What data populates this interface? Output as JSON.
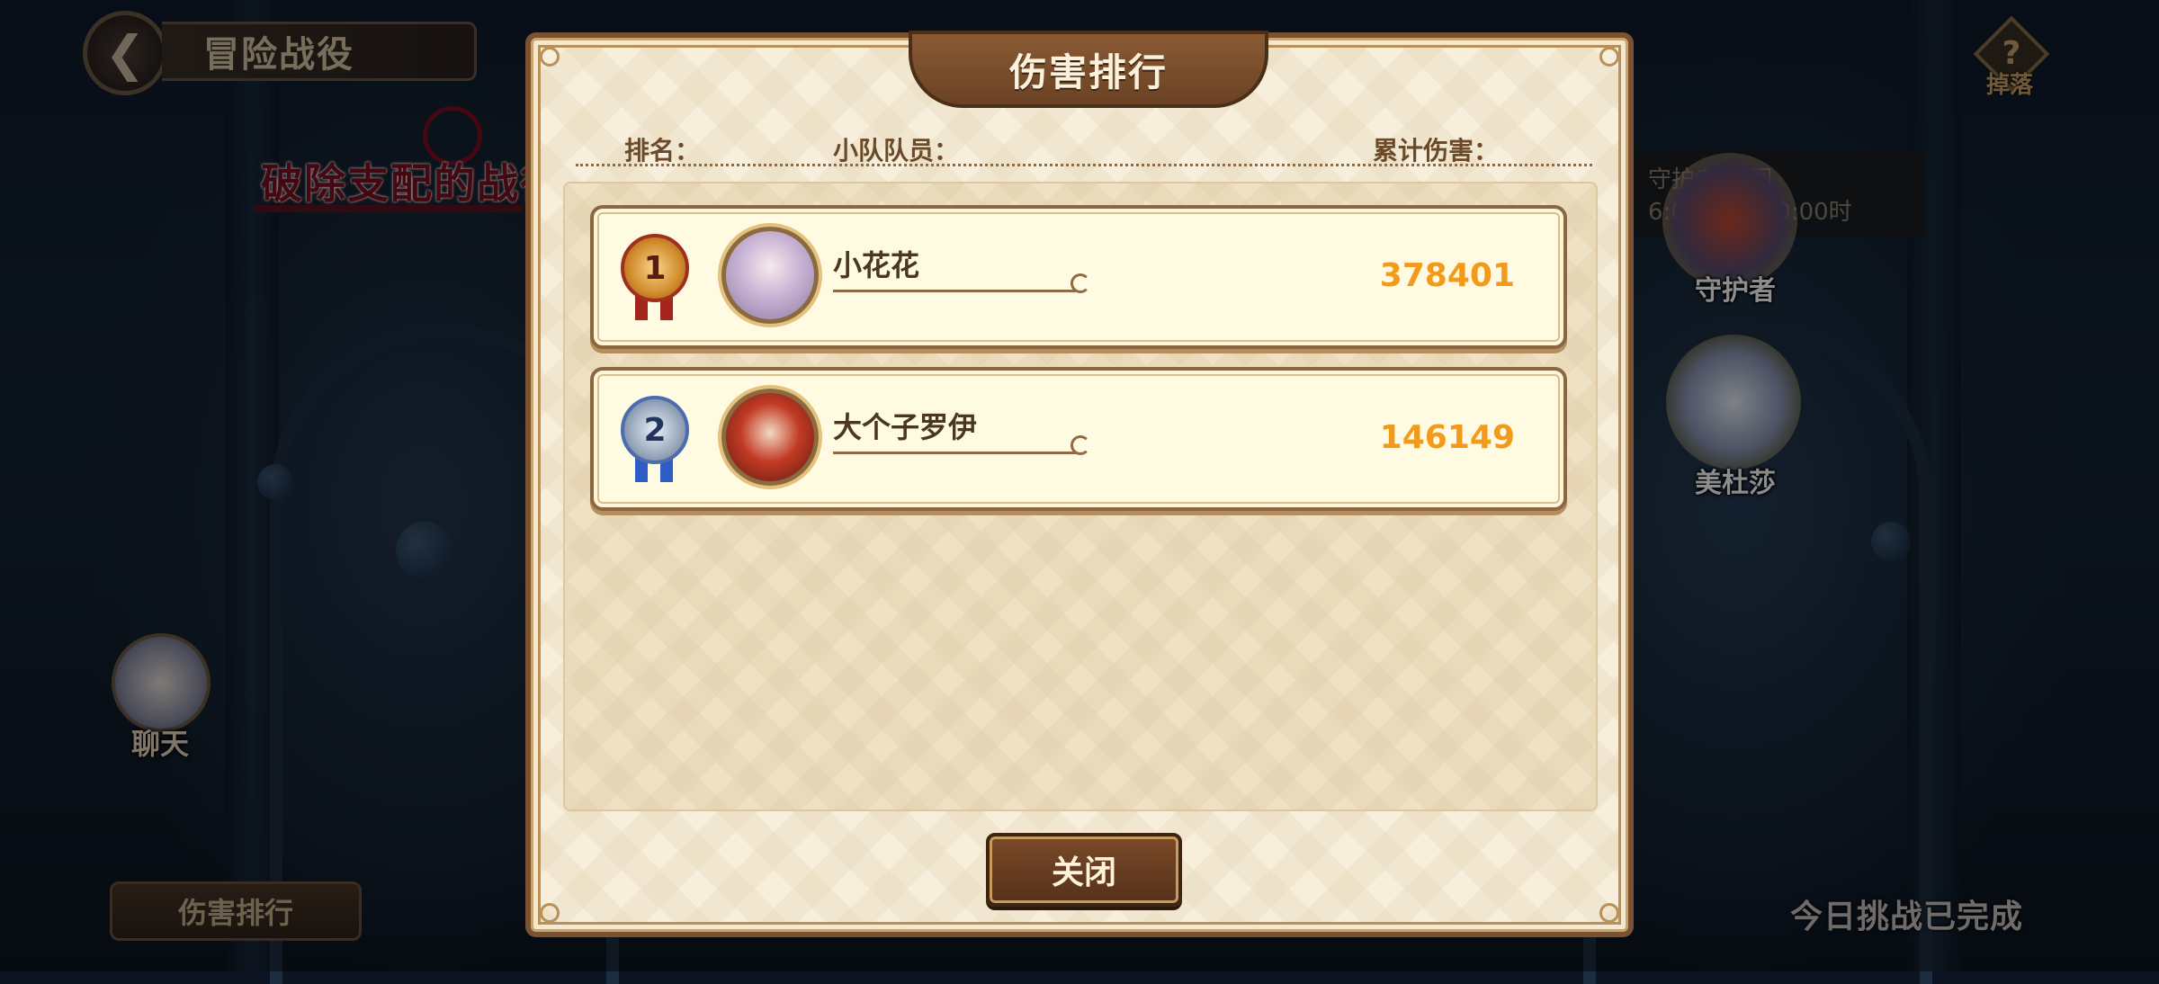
{
  "top_bar": {
    "back_icon": "back-arrow-icon",
    "title": "冒险战役"
  },
  "banner": {
    "title": "破除支配的战役"
  },
  "side": {
    "chat_label": "聊天",
    "rank_button": "伤害排行"
  },
  "help": {
    "icon": "question-mark-icon",
    "label": "掉落"
  },
  "info_strip": {
    "line1": "守护者 时间",
    "line2": "6:00 16日00:00时"
  },
  "bosses": [
    {
      "name": "守护者"
    },
    {
      "name": "美杜莎"
    }
  ],
  "status": {
    "daily_done": "今日挑战已完成"
  },
  "modal": {
    "title": "伤害排行",
    "headers": {
      "rank": "排名：",
      "members": "小队队员：",
      "damage": "累计伤害："
    },
    "rows": [
      {
        "rank": "1",
        "medal": "gold-medal-icon",
        "name": "小花花",
        "damage": "378401"
      },
      {
        "rank": "2",
        "medal": "silver-medal-icon",
        "name": "大个子罗伊",
        "damage": "146149"
      }
    ],
    "close_label": "关闭"
  },
  "colors": {
    "damage": "#f39a1b",
    "modal_bg": "#f7efdc",
    "frame": "#7a5232",
    "button": "#6a3c20"
  }
}
